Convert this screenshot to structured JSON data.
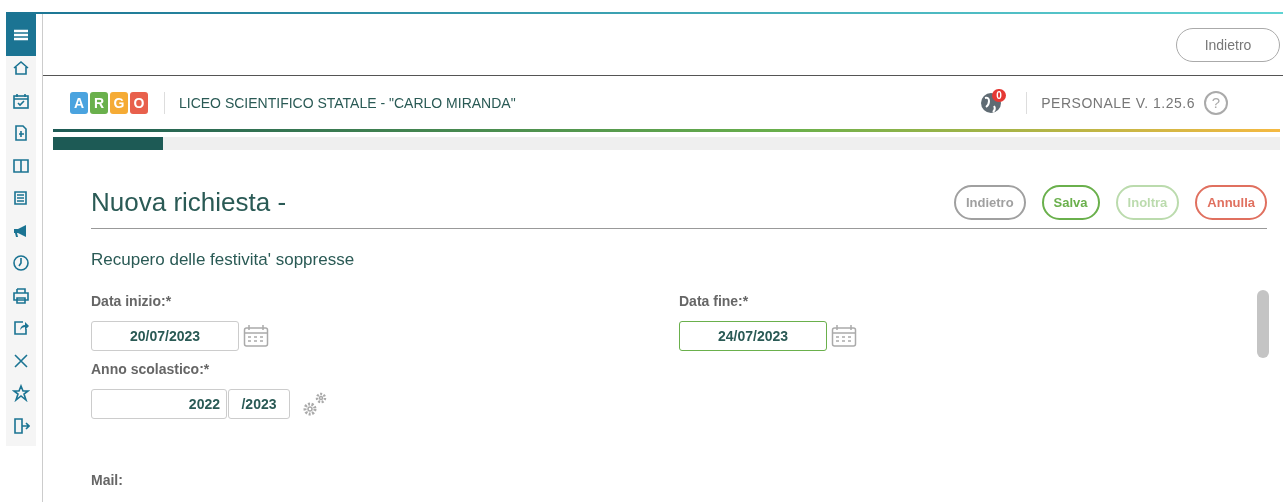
{
  "topbar": {
    "back_button": "Indietro"
  },
  "header": {
    "logo_letters": [
      {
        "letter": "A",
        "color": "#4aa3df"
      },
      {
        "letter": "R",
        "color": "#6ab04c"
      },
      {
        "letter": "G",
        "color": "#f5ab35"
      },
      {
        "letter": "O",
        "color": "#e8604c"
      }
    ],
    "school": "LICEO SCIENTIFICO STATALE - \"CARLO MIRANDA\"",
    "notifications": "0",
    "help": "?",
    "version": "PERSONALE V. 1.25.6"
  },
  "progress": {
    "level": 0.09
  },
  "form": {
    "title": "Nuova richiesta -",
    "buttons": [
      {
        "label": "Indietro",
        "kind": "back",
        "disabled": false
      },
      {
        "label": "Salva",
        "kind": "save",
        "disabled": false
      },
      {
        "label": "Inoltra",
        "kind": "save",
        "disabled": true
      },
      {
        "label": "Annulla",
        "kind": "cancel",
        "disabled": false
      }
    ],
    "subtitle": "Recupero delle festivita' soppresse",
    "start": {
      "label": "Data inizio:*",
      "value": "20/07/2023",
      "focused": false
    },
    "end": {
      "label": "Data fine:*",
      "value": "24/07/2023",
      "focused": true
    },
    "year": {
      "label": "Anno scolastico:*",
      "from": "2022",
      "to": "/2023"
    },
    "mail_label": "Mail:"
  }
}
